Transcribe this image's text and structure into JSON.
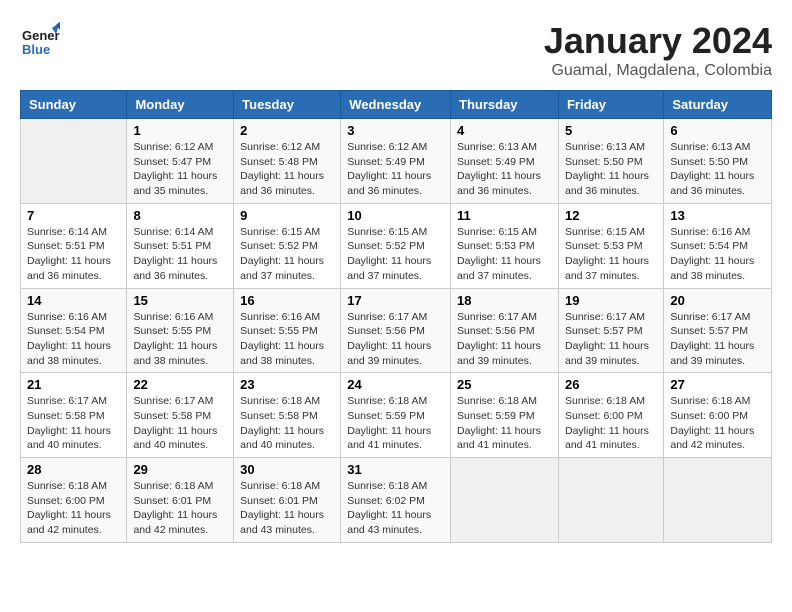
{
  "header": {
    "logo_general": "General",
    "logo_blue": "Blue",
    "title": "January 2024",
    "subtitle": "Guamal, Magdalena, Colombia"
  },
  "calendar": {
    "days_of_week": [
      "Sunday",
      "Monday",
      "Tuesday",
      "Wednesday",
      "Thursday",
      "Friday",
      "Saturday"
    ],
    "weeks": [
      [
        {
          "day": "",
          "info": ""
        },
        {
          "day": "1",
          "info": "Sunrise: 6:12 AM\nSunset: 5:47 PM\nDaylight: 11 hours\nand 35 minutes."
        },
        {
          "day": "2",
          "info": "Sunrise: 6:12 AM\nSunset: 5:48 PM\nDaylight: 11 hours\nand 36 minutes."
        },
        {
          "day": "3",
          "info": "Sunrise: 6:12 AM\nSunset: 5:49 PM\nDaylight: 11 hours\nand 36 minutes."
        },
        {
          "day": "4",
          "info": "Sunrise: 6:13 AM\nSunset: 5:49 PM\nDaylight: 11 hours\nand 36 minutes."
        },
        {
          "day": "5",
          "info": "Sunrise: 6:13 AM\nSunset: 5:50 PM\nDaylight: 11 hours\nand 36 minutes."
        },
        {
          "day": "6",
          "info": "Sunrise: 6:13 AM\nSunset: 5:50 PM\nDaylight: 11 hours\nand 36 minutes."
        }
      ],
      [
        {
          "day": "7",
          "info": "Sunrise: 6:14 AM\nSunset: 5:51 PM\nDaylight: 11 hours\nand 36 minutes."
        },
        {
          "day": "8",
          "info": "Sunrise: 6:14 AM\nSunset: 5:51 PM\nDaylight: 11 hours\nand 36 minutes."
        },
        {
          "day": "9",
          "info": "Sunrise: 6:15 AM\nSunset: 5:52 PM\nDaylight: 11 hours\nand 37 minutes."
        },
        {
          "day": "10",
          "info": "Sunrise: 6:15 AM\nSunset: 5:52 PM\nDaylight: 11 hours\nand 37 minutes."
        },
        {
          "day": "11",
          "info": "Sunrise: 6:15 AM\nSunset: 5:53 PM\nDaylight: 11 hours\nand 37 minutes."
        },
        {
          "day": "12",
          "info": "Sunrise: 6:15 AM\nSunset: 5:53 PM\nDaylight: 11 hours\nand 37 minutes."
        },
        {
          "day": "13",
          "info": "Sunrise: 6:16 AM\nSunset: 5:54 PM\nDaylight: 11 hours\nand 38 minutes."
        }
      ],
      [
        {
          "day": "14",
          "info": "Sunrise: 6:16 AM\nSunset: 5:54 PM\nDaylight: 11 hours\nand 38 minutes."
        },
        {
          "day": "15",
          "info": "Sunrise: 6:16 AM\nSunset: 5:55 PM\nDaylight: 11 hours\nand 38 minutes."
        },
        {
          "day": "16",
          "info": "Sunrise: 6:16 AM\nSunset: 5:55 PM\nDaylight: 11 hours\nand 38 minutes."
        },
        {
          "day": "17",
          "info": "Sunrise: 6:17 AM\nSunset: 5:56 PM\nDaylight: 11 hours\nand 39 minutes."
        },
        {
          "day": "18",
          "info": "Sunrise: 6:17 AM\nSunset: 5:56 PM\nDaylight: 11 hours\nand 39 minutes."
        },
        {
          "day": "19",
          "info": "Sunrise: 6:17 AM\nSunset: 5:57 PM\nDaylight: 11 hours\nand 39 minutes."
        },
        {
          "day": "20",
          "info": "Sunrise: 6:17 AM\nSunset: 5:57 PM\nDaylight: 11 hours\nand 39 minutes."
        }
      ],
      [
        {
          "day": "21",
          "info": "Sunrise: 6:17 AM\nSunset: 5:58 PM\nDaylight: 11 hours\nand 40 minutes."
        },
        {
          "day": "22",
          "info": "Sunrise: 6:17 AM\nSunset: 5:58 PM\nDaylight: 11 hours\nand 40 minutes."
        },
        {
          "day": "23",
          "info": "Sunrise: 6:18 AM\nSunset: 5:58 PM\nDaylight: 11 hours\nand 40 minutes."
        },
        {
          "day": "24",
          "info": "Sunrise: 6:18 AM\nSunset: 5:59 PM\nDaylight: 11 hours\nand 41 minutes."
        },
        {
          "day": "25",
          "info": "Sunrise: 6:18 AM\nSunset: 5:59 PM\nDaylight: 11 hours\nand 41 minutes."
        },
        {
          "day": "26",
          "info": "Sunrise: 6:18 AM\nSunset: 6:00 PM\nDaylight: 11 hours\nand 41 minutes."
        },
        {
          "day": "27",
          "info": "Sunrise: 6:18 AM\nSunset: 6:00 PM\nDaylight: 11 hours\nand 42 minutes."
        }
      ],
      [
        {
          "day": "28",
          "info": "Sunrise: 6:18 AM\nSunset: 6:00 PM\nDaylight: 11 hours\nand 42 minutes."
        },
        {
          "day": "29",
          "info": "Sunrise: 6:18 AM\nSunset: 6:01 PM\nDaylight: 11 hours\nand 42 minutes."
        },
        {
          "day": "30",
          "info": "Sunrise: 6:18 AM\nSunset: 6:01 PM\nDaylight: 11 hours\nand 43 minutes."
        },
        {
          "day": "31",
          "info": "Sunrise: 6:18 AM\nSunset: 6:02 PM\nDaylight: 11 hours\nand 43 minutes."
        },
        {
          "day": "",
          "info": ""
        },
        {
          "day": "",
          "info": ""
        },
        {
          "day": "",
          "info": ""
        }
      ]
    ]
  }
}
